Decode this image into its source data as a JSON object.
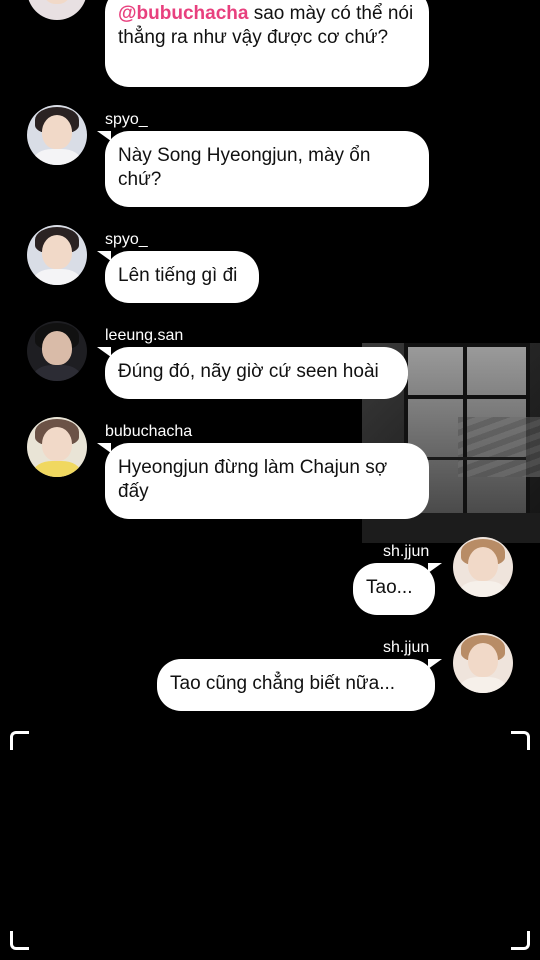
{
  "messages": [
    {
      "id": "m1",
      "side": "left",
      "username": "",
      "mention": "@bubuchacha",
      "text": " sao mày có thể nói thẳng ra như vậy được cơ chứ?"
    },
    {
      "id": "m2",
      "side": "left",
      "username": "spyo_",
      "text": "Này Song Hyeongjun, mày ổn chứ?"
    },
    {
      "id": "m3",
      "side": "left",
      "username": "spyo_",
      "text": "Lên tiếng gì đi"
    },
    {
      "id": "m4",
      "side": "left",
      "username": "leeung.san",
      "text": "Đúng đó, nãy giờ cứ seen hoài"
    },
    {
      "id": "m5",
      "side": "left",
      "username": "bubuchacha",
      "text": "Hyeongjun đừng làm Chajun sợ đấy"
    },
    {
      "id": "m6",
      "side": "right",
      "username": "sh.jjun",
      "text": "Tao..."
    },
    {
      "id": "m7",
      "side": "right",
      "username": "sh.jjun",
      "text": "Tao cũng chẳng biết nữa..."
    }
  ],
  "colors": {
    "background": "#000000",
    "bubble": "#ffffff",
    "mention": "#e8407e",
    "username": "#ffffff"
  }
}
